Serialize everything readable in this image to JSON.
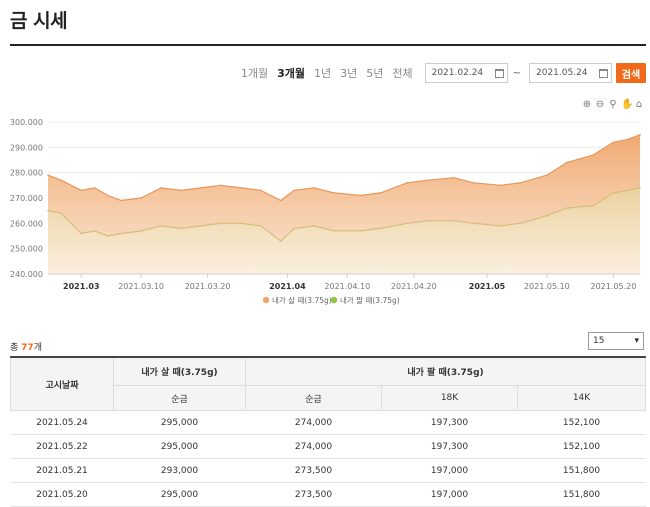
{
  "page": {
    "title": "금 시세"
  },
  "controls": {
    "periods": [
      "1개월",
      "3개월",
      "1년",
      "3년",
      "5년",
      "전체"
    ],
    "active_period": "3개월",
    "start_date": "2021.02.24",
    "separator": "~",
    "end_date": "2021.05.24",
    "search_label": "검색"
  },
  "toolbar_icons": [
    "zoom-in-icon",
    "zoom-out-icon",
    "magnifier-icon",
    "pan-hand-icon",
    "home-icon"
  ],
  "chart_data": {
    "type": "area",
    "title": "",
    "xlabel": "",
    "ylabel": "",
    "ylim": [
      240000,
      300000
    ],
    "yticks": [
      240000,
      250000,
      260000,
      270000,
      280000,
      290000,
      300000
    ],
    "ytick_labels": [
      "240.000",
      "250.000",
      "260.000",
      "270.000",
      "280.000",
      "290.000",
      "300.000"
    ],
    "x": [
      "2021-02-24",
      "2021-02-26",
      "2021-03-01",
      "2021-03-03",
      "2021-03-05",
      "2021-03-07",
      "2021-03-10",
      "2021-03-13",
      "2021-03-16",
      "2021-03-19",
      "2021-03-22",
      "2021-03-25",
      "2021-03-28",
      "2021-03-31",
      "2021-04-02",
      "2021-04-05",
      "2021-04-08",
      "2021-04-12",
      "2021-04-15",
      "2021-04-19",
      "2021-04-22",
      "2021-04-26",
      "2021-04-29",
      "2021-05-03",
      "2021-05-06",
      "2021-05-10",
      "2021-05-13",
      "2021-05-17",
      "2021-05-20",
      "2021-05-22",
      "2021-05-24"
    ],
    "xticks": [
      "2021-03-01",
      "2021-03-10",
      "2021-03-20",
      "2021-04-01",
      "2021-04-10",
      "2021-04-20",
      "2021-05-01",
      "2021-05-10",
      "2021-05-20"
    ],
    "xtick_labels": [
      "2021.03",
      "2021.03.10",
      "2021.03.20",
      "2021.04",
      "2021.04.10",
      "2021.04.20",
      "2021.05",
      "2021.05.10",
      "2021.05.20"
    ],
    "xtick_bold": [
      true,
      false,
      false,
      true,
      false,
      false,
      true,
      false,
      false
    ],
    "series": [
      {
        "name": "내가 살 때(3.75g)",
        "color": "#f0a56a",
        "values": [
          279000,
          277000,
          273000,
          274000,
          271000,
          269000,
          270000,
          274000,
          273000,
          274000,
          275000,
          274000,
          273000,
          269000,
          273000,
          274000,
          272000,
          271000,
          272000,
          276000,
          277000,
          278000,
          276000,
          275000,
          276000,
          279000,
          284000,
          287000,
          292000,
          293000,
          295000
        ]
      },
      {
        "name": "내가 팔 때(3.75g)",
        "color": "#8dc63f",
        "values": [
          265000,
          264000,
          256000,
          257000,
          255000,
          256000,
          257000,
          259000,
          258000,
          259000,
          260000,
          260000,
          259000,
          253000,
          258000,
          259000,
          257000,
          257000,
          258000,
          260000,
          261000,
          261000,
          260000,
          259000,
          260000,
          263000,
          266000,
          267000,
          272000,
          273000,
          274000
        ]
      }
    ],
    "legend_position": "bottom"
  },
  "list": {
    "total_prefix": "총",
    "total_count": "77",
    "total_suffix": "개",
    "page_size": "15",
    "headers": {
      "date": "고시날짜",
      "buy_group": "내가 살 때(3.75g)",
      "sell_group": "내가 팔 때(3.75g)",
      "buy_pure": "순금",
      "sell_pure": "순금",
      "sell_18k": "18K",
      "sell_14k": "14K"
    },
    "rows": [
      [
        "2021.05.24",
        "295,000",
        "274,000",
        "197,300",
        "152,100"
      ],
      [
        "2021.05.22",
        "295,000",
        "274,000",
        "197,300",
        "152,100"
      ],
      [
        "2021.05.21",
        "293,000",
        "273,500",
        "197,000",
        "151,800"
      ],
      [
        "2021.05.20",
        "295,000",
        "273,500",
        "197,000",
        "151,800"
      ]
    ]
  }
}
